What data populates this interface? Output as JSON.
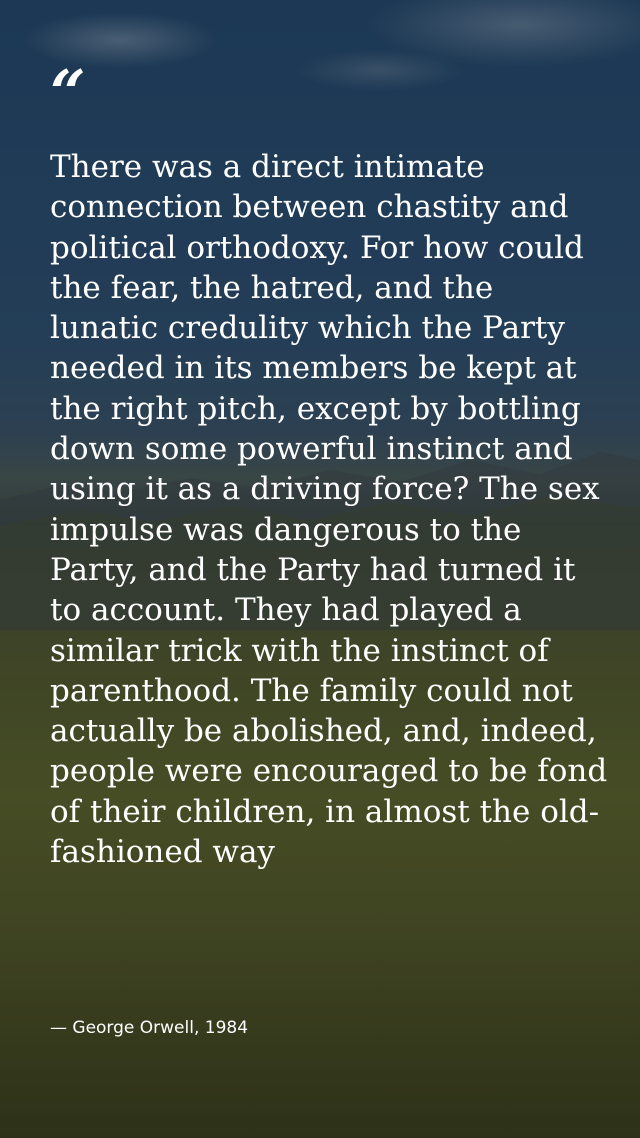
{
  "quote": {
    "mark": "“",
    "text": "There was a direct intimate connection between chastity and political orthodoxy. For how could the fear, the hatred, and the lunatic credulity which the Party needed in its members be kept at the right pitch, except by bottling down some powerful instinct and using it as a driving force? The sex impulse was dangerous to the Party, and the Party had turned it to account. They had played a similar trick with the instinct of parenthood. The family could not actually be abolished, and, indeed, people were encouraged to be fond of their children, in almost the old-fashioned way",
    "attribution": "— George Orwell, 1984"
  },
  "colors": {
    "text": "#ffffff",
    "sky": "#24486c",
    "grass": "#525a30"
  }
}
